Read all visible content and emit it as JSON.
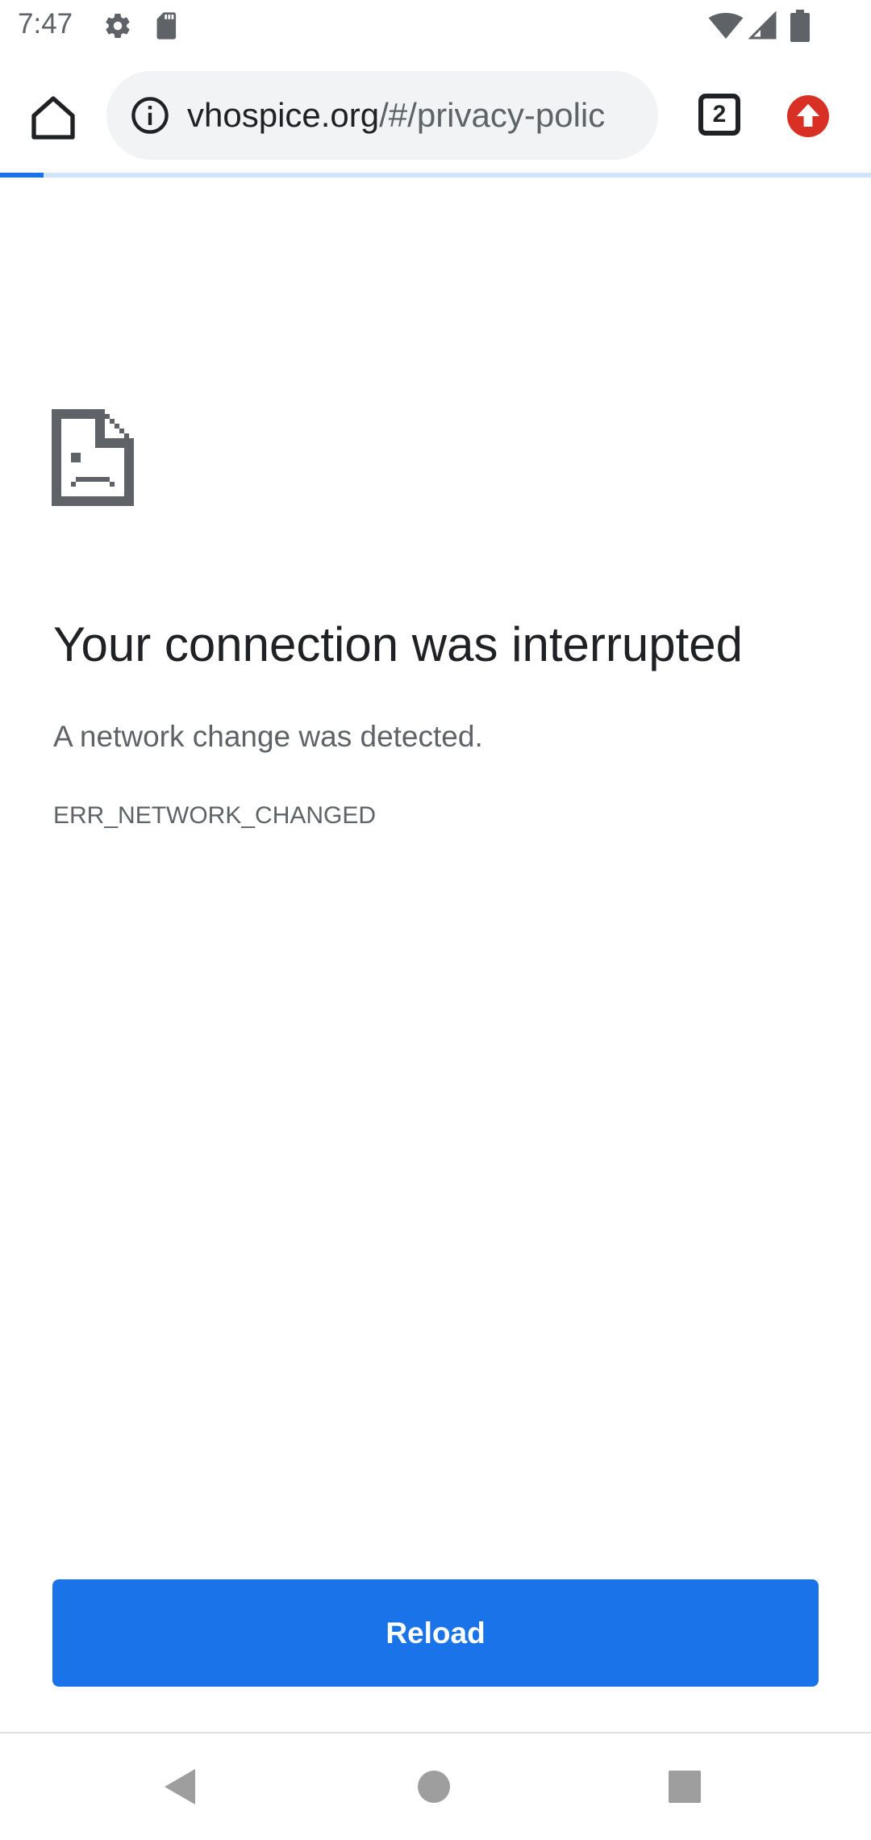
{
  "status_bar": {
    "time": "7:47",
    "left_icons": [
      "gear-icon",
      "sd-card-icon"
    ],
    "right_icons": [
      "wifi-icon",
      "cell-signal-icon",
      "battery-icon"
    ]
  },
  "toolbar": {
    "url_domain": "vhospice.org",
    "url_path": "/#/privacy-polic",
    "tab_count": "2",
    "icons": [
      "home-icon",
      "info-icon",
      "tab-switcher-icon",
      "update-icon"
    ]
  },
  "loading": {
    "progress_fraction": 0.05
  },
  "error_page": {
    "icon": "sad-document-icon",
    "title": "Your connection was interrupted",
    "description": "A network change was detected.",
    "code": "ERR_NETWORK_CHANGED",
    "reload_label": "Reload"
  },
  "colors": {
    "accent": "#1a73e8",
    "update_badge": "#d93025",
    "text_primary": "#202124",
    "text_secondary": "#5f6368"
  }
}
